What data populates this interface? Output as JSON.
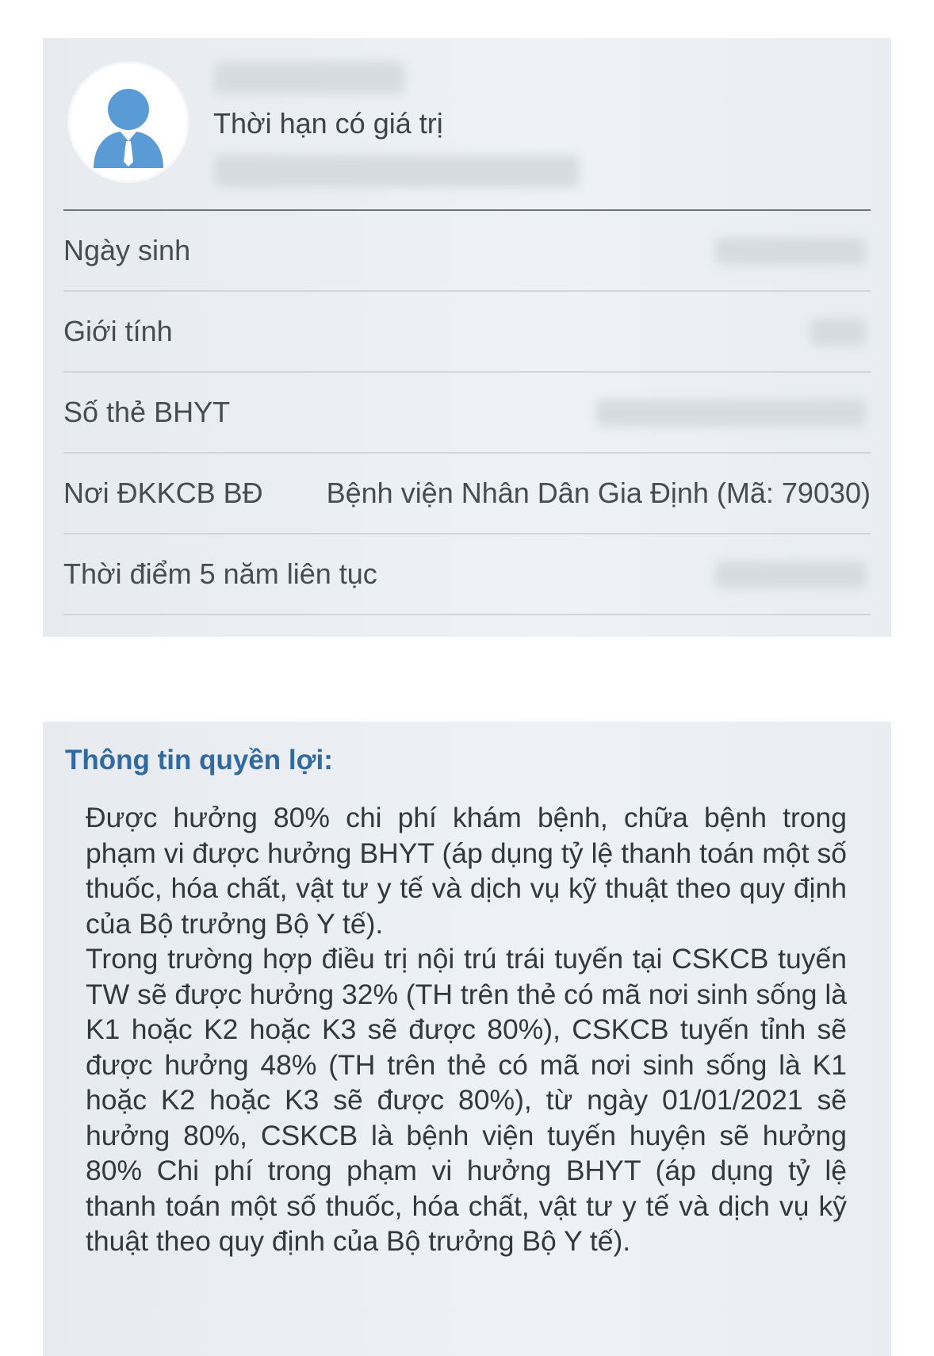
{
  "profile": {
    "validity_label": "Thời hạn có giá trị",
    "rows": [
      {
        "label": "Ngày sinh",
        "value": ""
      },
      {
        "label": "Giới tính",
        "value": ""
      },
      {
        "label": "Số thẻ BHYT",
        "value": ""
      },
      {
        "label": "Nơi ĐKKCB BĐ",
        "value": "Bệnh viện Nhân Dân Gia Định (Mã: 79030)"
      },
      {
        "label": "Thời điểm 5 năm liên tục",
        "value": ""
      }
    ]
  },
  "benefits": {
    "title": "Thông tin quyền lợi:",
    "paragraphs": [
      "Được hưởng 80% chi phí khám bệnh, chữa bệnh trong phạm vi được hưởng BHYT (áp dụng tỷ lệ thanh toán một số thuốc, hóa chất, vật tư y tế và dịch vụ kỹ thuật theo quy định của Bộ trưởng Bộ Y tế).",
      "Trong trường hợp điều trị nội trú trái tuyến tại CSKCB tuyến TW sẽ được hưởng 32% (TH trên thẻ có mã nơi sinh sống là K1 hoặc K2 hoặc K3 sẽ được 80%), CSKCB tuyến tỉnh sẽ được hưởng 48% (TH trên thẻ có mã nơi sinh sống là K1 hoặc K2 hoặc K3 sẽ được 80%), từ ngày 01/01/2021 sẽ hưởng 80%, CSKCB là bệnh viện tuyến huyện sẽ hưởng 80% Chi phí trong phạm vi hưởng BHYT (áp dụng tỷ lệ thanh toán một số thuốc, hóa chất, vật tư y tế và dịch vụ kỹ thuật theo quy định của Bộ trưởng Bộ Y tế)."
    ]
  },
  "colors": {
    "card_background": "#eceff3",
    "title_blue": "#2f6aa3",
    "avatar_blue": "#5b9bd5"
  }
}
